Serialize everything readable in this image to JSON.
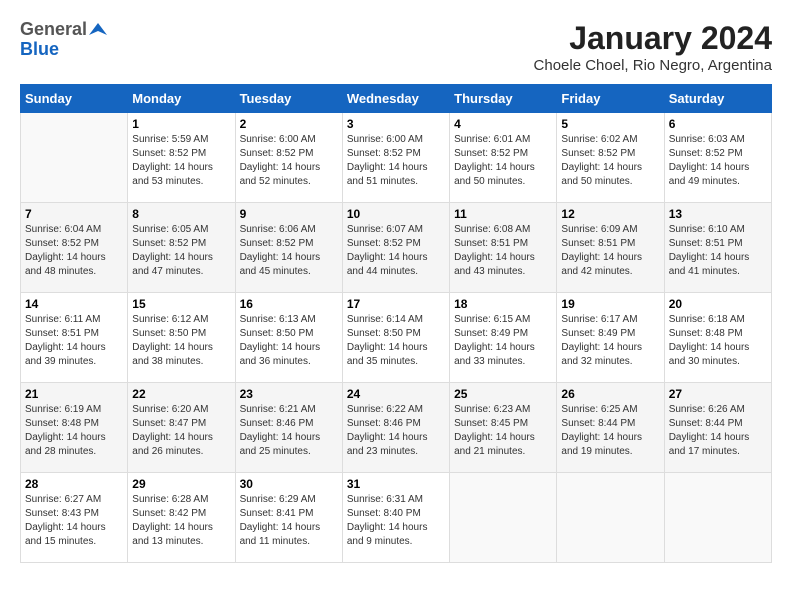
{
  "logo": {
    "general": "General",
    "blue": "Blue"
  },
  "title": "January 2024",
  "subtitle": "Choele Choel, Rio Negro, Argentina",
  "days_of_week": [
    "Sunday",
    "Monday",
    "Tuesday",
    "Wednesday",
    "Thursday",
    "Friday",
    "Saturday"
  ],
  "weeks": [
    [
      {
        "day": "",
        "content": ""
      },
      {
        "day": "1",
        "content": "Sunrise: 5:59 AM\nSunset: 8:52 PM\nDaylight: 14 hours\nand 53 minutes."
      },
      {
        "day": "2",
        "content": "Sunrise: 6:00 AM\nSunset: 8:52 PM\nDaylight: 14 hours\nand 52 minutes."
      },
      {
        "day": "3",
        "content": "Sunrise: 6:00 AM\nSunset: 8:52 PM\nDaylight: 14 hours\nand 51 minutes."
      },
      {
        "day": "4",
        "content": "Sunrise: 6:01 AM\nSunset: 8:52 PM\nDaylight: 14 hours\nand 50 minutes."
      },
      {
        "day": "5",
        "content": "Sunrise: 6:02 AM\nSunset: 8:52 PM\nDaylight: 14 hours\nand 50 minutes."
      },
      {
        "day": "6",
        "content": "Sunrise: 6:03 AM\nSunset: 8:52 PM\nDaylight: 14 hours\nand 49 minutes."
      }
    ],
    [
      {
        "day": "7",
        "content": "Sunrise: 6:04 AM\nSunset: 8:52 PM\nDaylight: 14 hours\nand 48 minutes."
      },
      {
        "day": "8",
        "content": "Sunrise: 6:05 AM\nSunset: 8:52 PM\nDaylight: 14 hours\nand 47 minutes."
      },
      {
        "day": "9",
        "content": "Sunrise: 6:06 AM\nSunset: 8:52 PM\nDaylight: 14 hours\nand 45 minutes."
      },
      {
        "day": "10",
        "content": "Sunrise: 6:07 AM\nSunset: 8:52 PM\nDaylight: 14 hours\nand 44 minutes."
      },
      {
        "day": "11",
        "content": "Sunrise: 6:08 AM\nSunset: 8:51 PM\nDaylight: 14 hours\nand 43 minutes."
      },
      {
        "day": "12",
        "content": "Sunrise: 6:09 AM\nSunset: 8:51 PM\nDaylight: 14 hours\nand 42 minutes."
      },
      {
        "day": "13",
        "content": "Sunrise: 6:10 AM\nSunset: 8:51 PM\nDaylight: 14 hours\nand 41 minutes."
      }
    ],
    [
      {
        "day": "14",
        "content": "Sunrise: 6:11 AM\nSunset: 8:51 PM\nDaylight: 14 hours\nand 39 minutes."
      },
      {
        "day": "15",
        "content": "Sunrise: 6:12 AM\nSunset: 8:50 PM\nDaylight: 14 hours\nand 38 minutes."
      },
      {
        "day": "16",
        "content": "Sunrise: 6:13 AM\nSunset: 8:50 PM\nDaylight: 14 hours\nand 36 minutes."
      },
      {
        "day": "17",
        "content": "Sunrise: 6:14 AM\nSunset: 8:50 PM\nDaylight: 14 hours\nand 35 minutes."
      },
      {
        "day": "18",
        "content": "Sunrise: 6:15 AM\nSunset: 8:49 PM\nDaylight: 14 hours\nand 33 minutes."
      },
      {
        "day": "19",
        "content": "Sunrise: 6:17 AM\nSunset: 8:49 PM\nDaylight: 14 hours\nand 32 minutes."
      },
      {
        "day": "20",
        "content": "Sunrise: 6:18 AM\nSunset: 8:48 PM\nDaylight: 14 hours\nand 30 minutes."
      }
    ],
    [
      {
        "day": "21",
        "content": "Sunrise: 6:19 AM\nSunset: 8:48 PM\nDaylight: 14 hours\nand 28 minutes."
      },
      {
        "day": "22",
        "content": "Sunrise: 6:20 AM\nSunset: 8:47 PM\nDaylight: 14 hours\nand 26 minutes."
      },
      {
        "day": "23",
        "content": "Sunrise: 6:21 AM\nSunset: 8:46 PM\nDaylight: 14 hours\nand 25 minutes."
      },
      {
        "day": "24",
        "content": "Sunrise: 6:22 AM\nSunset: 8:46 PM\nDaylight: 14 hours\nand 23 minutes."
      },
      {
        "day": "25",
        "content": "Sunrise: 6:23 AM\nSunset: 8:45 PM\nDaylight: 14 hours\nand 21 minutes."
      },
      {
        "day": "26",
        "content": "Sunrise: 6:25 AM\nSunset: 8:44 PM\nDaylight: 14 hours\nand 19 minutes."
      },
      {
        "day": "27",
        "content": "Sunrise: 6:26 AM\nSunset: 8:44 PM\nDaylight: 14 hours\nand 17 minutes."
      }
    ],
    [
      {
        "day": "28",
        "content": "Sunrise: 6:27 AM\nSunset: 8:43 PM\nDaylight: 14 hours\nand 15 minutes."
      },
      {
        "day": "29",
        "content": "Sunrise: 6:28 AM\nSunset: 8:42 PM\nDaylight: 14 hours\nand 13 minutes."
      },
      {
        "day": "30",
        "content": "Sunrise: 6:29 AM\nSunset: 8:41 PM\nDaylight: 14 hours\nand 11 minutes."
      },
      {
        "day": "31",
        "content": "Sunrise: 6:31 AM\nSunset: 8:40 PM\nDaylight: 14 hours\nand 9 minutes."
      },
      {
        "day": "",
        "content": ""
      },
      {
        "day": "",
        "content": ""
      },
      {
        "day": "",
        "content": ""
      }
    ]
  ]
}
